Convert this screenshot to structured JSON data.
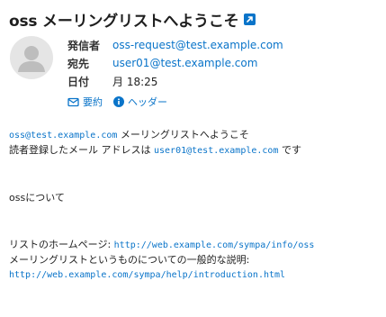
{
  "message": {
    "subject": "oss メーリングリストへようこそ",
    "open_icon": "external-link-icon",
    "sender_label": "発信者",
    "sender": "oss-request@test.example.com",
    "to_label": "宛先",
    "to": "user01@test.example.com",
    "date_label": "日付",
    "date": "月 18:25",
    "summary_label": "要約",
    "summary_icon": "envelope-icon",
    "headers_label": "ヘッダー",
    "headers_icon": "info-icon",
    "avatar_icon": "person-icon"
  },
  "body": {
    "list_address": "oss@test.example.com",
    "welcome_text": "メーリングリストへようこそ",
    "registered_prefix": "読者登録したメール アドレスは",
    "registered_address": "user01@test.example.com",
    "registered_suffix": "です",
    "about": "ossについて",
    "homepage_label": "リストのホームページ:",
    "homepage_url": "http://web.example.com/sympa/info/oss",
    "general_info_label": "メーリングリストというものについての一般的な説明:",
    "general_info_url": "http://web.example.com/sympa/help/introduction.html"
  },
  "colors": {
    "link": "#0a74c9",
    "text": "#222222",
    "avatar_bg": "#e5e5e5",
    "avatar_fg": "#bdbdbd"
  }
}
